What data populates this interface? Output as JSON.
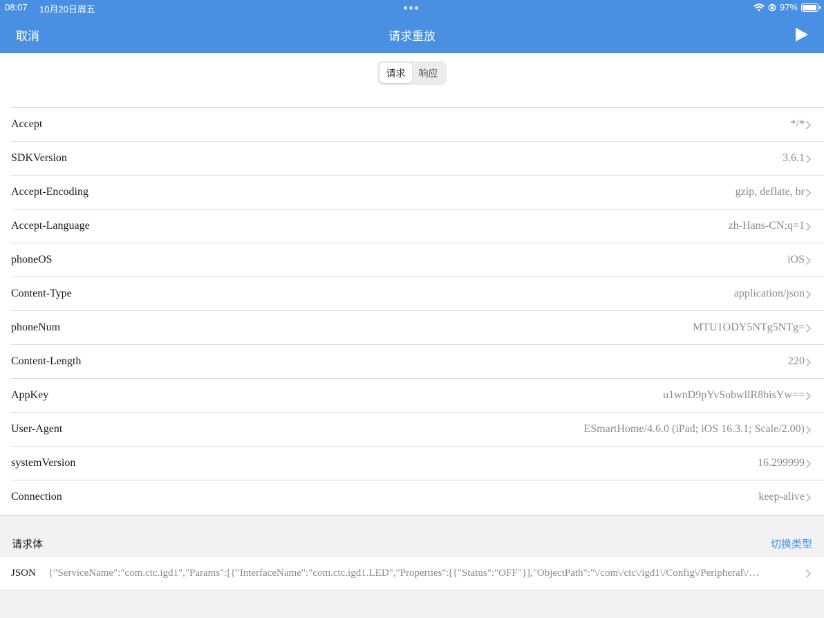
{
  "status": {
    "time": "08:07",
    "date": "10月20日周五",
    "battery": "97%",
    "battery_level": 0.97
  },
  "nav": {
    "cancel": "取消",
    "title": "请求重放"
  },
  "segment": {
    "items": [
      "请求",
      "响应"
    ],
    "selected": "请求"
  },
  "headers": [
    {
      "key": "Accept",
      "value": "*/*"
    },
    {
      "key": "SDKVersion",
      "value": "3.6.1"
    },
    {
      "key": "Accept-Encoding",
      "value": "gzip, deflate, br"
    },
    {
      "key": "Accept-Language",
      "value": "zh-Hans-CN;q=1"
    },
    {
      "key": "phoneOS",
      "value": "iOS"
    },
    {
      "key": "Content-Type",
      "value": "application/json"
    },
    {
      "key": "phoneNum",
      "value": "MTU1ODY5NTg5NTg="
    },
    {
      "key": "Content-Length",
      "value": "220"
    },
    {
      "key": "AppKey",
      "value": "u1wnD9pYvSobwllR8bisYw=="
    },
    {
      "key": "User-Agent",
      "value": "ESmartHome/4.6.0 (iPad; iOS 16.3.1; Scale/2.00)"
    },
    {
      "key": "systemVersion",
      "value": "16.299999"
    },
    {
      "key": "Connection",
      "value": "keep-alive"
    }
  ],
  "body_section": {
    "label": "请求体",
    "action": "切换类型",
    "type": "JSON",
    "value": "{\"ServiceName\":\"com.ctc.igd1\",\"Params\":[{\"InterfaceName\":\"com.ctc.igd1.LED\",\"Properties\":[{\"Status\":\"OFF\"}],\"ObjectPath\":\"\\/com\\/ctc\\/igd1\\/Config\\/Peripheral\\/…"
  },
  "colors": {
    "nav_bar": "#4a90e2",
    "link": "#3a8ee6",
    "value_text": "#8a8a8a"
  }
}
